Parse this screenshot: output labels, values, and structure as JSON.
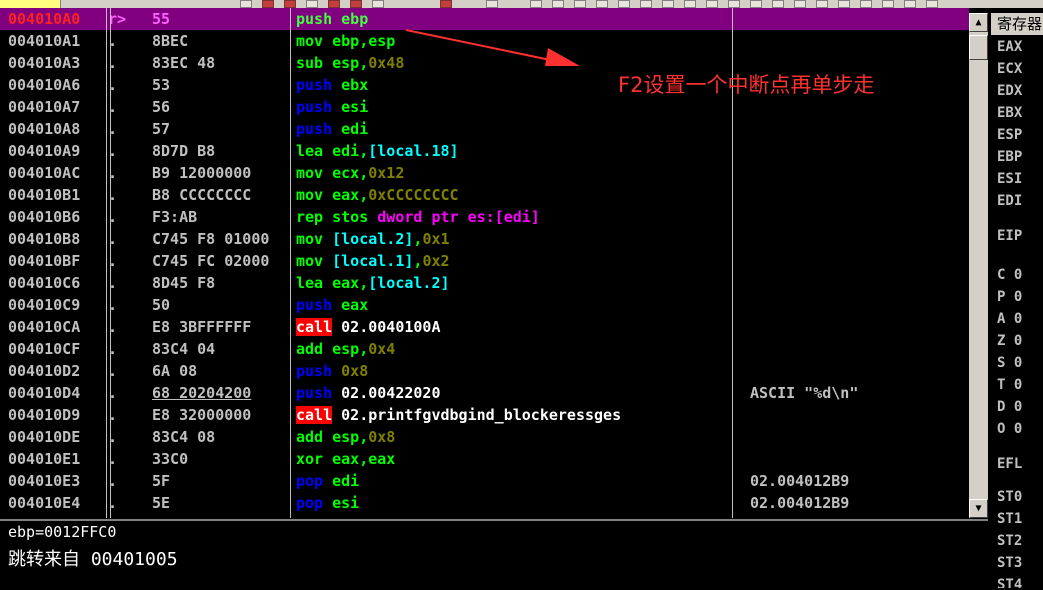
{
  "disasm": {
    "rows": [
      {
        "addr": "004010A0",
        "mark": "r>",
        "hex": "55",
        "asm": [
          {
            "t": "push",
            "c": "tok-sel"
          },
          {
            "t": " ebp",
            "c": "tok-sel"
          }
        ],
        "cmt": "",
        "sel": true
      },
      {
        "addr": "004010A1",
        "mark": ".",
        "hex": "8BEC",
        "asm": [
          {
            "t": "mov",
            "c": "tok-m"
          },
          {
            "t": " ebp,esp",
            "c": "tok-r"
          }
        ],
        "cmt": ""
      },
      {
        "addr": "004010A3",
        "mark": ".",
        "hex": "83EC 48",
        "asm": [
          {
            "t": "sub",
            "c": "tok-m"
          },
          {
            "t": " esp,",
            "c": "tok-r"
          },
          {
            "t": "0x48",
            "c": "tok-n"
          }
        ],
        "cmt": ""
      },
      {
        "addr": "004010A6",
        "mark": ".",
        "hex": "53",
        "asm": [
          {
            "t": "push",
            "c": "tok-s"
          },
          {
            "t": " ebx",
            "c": "tok-r"
          }
        ],
        "cmt": ""
      },
      {
        "addr": "004010A7",
        "mark": ".",
        "hex": "56",
        "asm": [
          {
            "t": "push",
            "c": "tok-s"
          },
          {
            "t": " esi",
            "c": "tok-r"
          }
        ],
        "cmt": ""
      },
      {
        "addr": "004010A8",
        "mark": ".",
        "hex": "57",
        "asm": [
          {
            "t": "push",
            "c": "tok-s"
          },
          {
            "t": " edi",
            "c": "tok-r"
          }
        ],
        "cmt": ""
      },
      {
        "addr": "004010A9",
        "mark": ".",
        "hex": "8D7D B8",
        "asm": [
          {
            "t": "lea",
            "c": "tok-m"
          },
          {
            "t": " edi,",
            "c": "tok-r"
          },
          {
            "t": "[local.18]",
            "c": "tok-b"
          }
        ],
        "cmt": ""
      },
      {
        "addr": "004010AC",
        "mark": ".",
        "hex": "B9 12000000",
        "asm": [
          {
            "t": "mov",
            "c": "tok-m"
          },
          {
            "t": " ecx,",
            "c": "tok-r"
          },
          {
            "t": "0x12",
            "c": "tok-n"
          }
        ],
        "cmt": ""
      },
      {
        "addr": "004010B1",
        "mark": ".",
        "hex": "B8 CCCCCCCC",
        "asm": [
          {
            "t": "mov",
            "c": "tok-m"
          },
          {
            "t": " eax,",
            "c": "tok-r"
          },
          {
            "t": "0xCCCCCCCC",
            "c": "tok-n"
          }
        ],
        "cmt": ""
      },
      {
        "addr": "004010B6",
        "mark": ".",
        "hex": "F3:AB",
        "asm": [
          {
            "t": "rep stos",
            "c": "tok-m"
          },
          {
            "t": " dword ptr es:",
            "c": "tok-k"
          },
          {
            "t": "[edi]",
            "c": "tok-k"
          }
        ],
        "cmt": ""
      },
      {
        "addr": "004010B8",
        "mark": ".",
        "hex": "C745 F8 01000",
        "asm": [
          {
            "t": "mov",
            "c": "tok-m"
          },
          {
            "t": " ",
            "c": "tok-r"
          },
          {
            "t": "[local.2]",
            "c": "tok-b"
          },
          {
            "t": ",",
            "c": "tok-r"
          },
          {
            "t": "0x1",
            "c": "tok-n"
          }
        ],
        "cmt": ""
      },
      {
        "addr": "004010BF",
        "mark": ".",
        "hex": "C745 FC 02000",
        "asm": [
          {
            "t": "mov",
            "c": "tok-m"
          },
          {
            "t": " ",
            "c": "tok-r"
          },
          {
            "t": "[local.1]",
            "c": "tok-b"
          },
          {
            "t": ",",
            "c": "tok-r"
          },
          {
            "t": "0x2",
            "c": "tok-n"
          }
        ],
        "cmt": ""
      },
      {
        "addr": "004010C6",
        "mark": ".",
        "hex": "8D45 F8",
        "asm": [
          {
            "t": "lea",
            "c": "tok-m"
          },
          {
            "t": " eax,",
            "c": "tok-r"
          },
          {
            "t": "[local.2]",
            "c": "tok-b"
          }
        ],
        "cmt": ""
      },
      {
        "addr": "004010C9",
        "mark": ".",
        "hex": "50",
        "asm": [
          {
            "t": "push",
            "c": "tok-s"
          },
          {
            "t": " eax",
            "c": "tok-r"
          }
        ],
        "cmt": ""
      },
      {
        "addr": "004010CA",
        "mark": ".",
        "hex": "E8 3BFFFFFF",
        "asm": [
          {
            "t": "call",
            "c": "tok-c"
          },
          {
            "t": " 02.0040100A",
            "c": "tok-w"
          }
        ],
        "cmt": ""
      },
      {
        "addr": "004010CF",
        "mark": ".",
        "hex": "83C4 04",
        "asm": [
          {
            "t": "add",
            "c": "tok-m"
          },
          {
            "t": " esp,",
            "c": "tok-r"
          },
          {
            "t": "0x4",
            "c": "tok-n"
          }
        ],
        "cmt": ""
      },
      {
        "addr": "004010D2",
        "mark": ".",
        "hex": "6A 08",
        "asm": [
          {
            "t": "push",
            "c": "tok-s"
          },
          {
            "t": " ",
            "c": "tok-r"
          },
          {
            "t": "0x8",
            "c": "tok-n"
          }
        ],
        "cmt": ""
      },
      {
        "addr": "004010D4",
        "mark": ".",
        "hex": "68 20204200",
        "hexul": true,
        "asm": [
          {
            "t": "push",
            "c": "tok-s"
          },
          {
            "t": " 02.00422020",
            "c": "tok-w"
          }
        ],
        "cmt": "ASCII \"%d\\n\""
      },
      {
        "addr": "004010D9",
        "mark": ".",
        "hex": "E8 32000000",
        "asm": [
          {
            "t": "call",
            "c": "tok-c"
          },
          {
            "t": " 02.printfgvdbgind_blockeressges",
            "c": "tok-w"
          }
        ],
        "cmt": ""
      },
      {
        "addr": "004010DE",
        "mark": ".",
        "hex": "83C4 08",
        "asm": [
          {
            "t": "add",
            "c": "tok-m"
          },
          {
            "t": " esp,",
            "c": "tok-r"
          },
          {
            "t": "0x8",
            "c": "tok-n"
          }
        ],
        "cmt": ""
      },
      {
        "addr": "004010E1",
        "mark": ".",
        "hex": "33C0",
        "asm": [
          {
            "t": "xor",
            "c": "tok-m"
          },
          {
            "t": " eax,eax",
            "c": "tok-r"
          }
        ],
        "cmt": ""
      },
      {
        "addr": "004010E3",
        "mark": ".",
        "hex": "5F",
        "asm": [
          {
            "t": "pop",
            "c": "tok-s"
          },
          {
            "t": " edi",
            "c": "tok-r"
          }
        ],
        "cmt": "02.004012B9"
      },
      {
        "addr": "004010E4",
        "mark": ".",
        "hex": "5E",
        "asm": [
          {
            "t": "pop",
            "c": "tok-s"
          },
          {
            "t": " esi",
            "c": "tok-r"
          }
        ],
        "cmt": "02.004012B9"
      }
    ]
  },
  "registers": {
    "title": "寄存器",
    "lines": [
      {
        "label": "EAX"
      },
      {
        "label": "ECX"
      },
      {
        "label": "EDX"
      },
      {
        "label": "EBX"
      },
      {
        "label": "ESP"
      },
      {
        "label": "EBP"
      },
      {
        "label": "ESI"
      },
      {
        "label": "EDI"
      },
      {
        "label": "EIP"
      },
      {
        "label": "C 0"
      },
      {
        "label": "P 0"
      },
      {
        "label": "A 0"
      },
      {
        "label": "Z 0"
      },
      {
        "label": "S 0"
      },
      {
        "label": "T 0"
      },
      {
        "label": "D 0"
      },
      {
        "label": "O 0"
      },
      {
        "label": "EFL"
      },
      {
        "label": "ST0"
      },
      {
        "label": "ST1"
      },
      {
        "label": "ST2"
      },
      {
        "label": "ST3"
      },
      {
        "label": "ST4"
      }
    ]
  },
  "info": {
    "line1": "ebp=0012FFC0",
    "line2": "跳转来自 00401005"
  },
  "annotation": {
    "text": "F2设置一个中断点再单步走",
    "color": "#ff3030"
  },
  "colors": {
    "selected_row": "#800080",
    "background": "#000000"
  }
}
